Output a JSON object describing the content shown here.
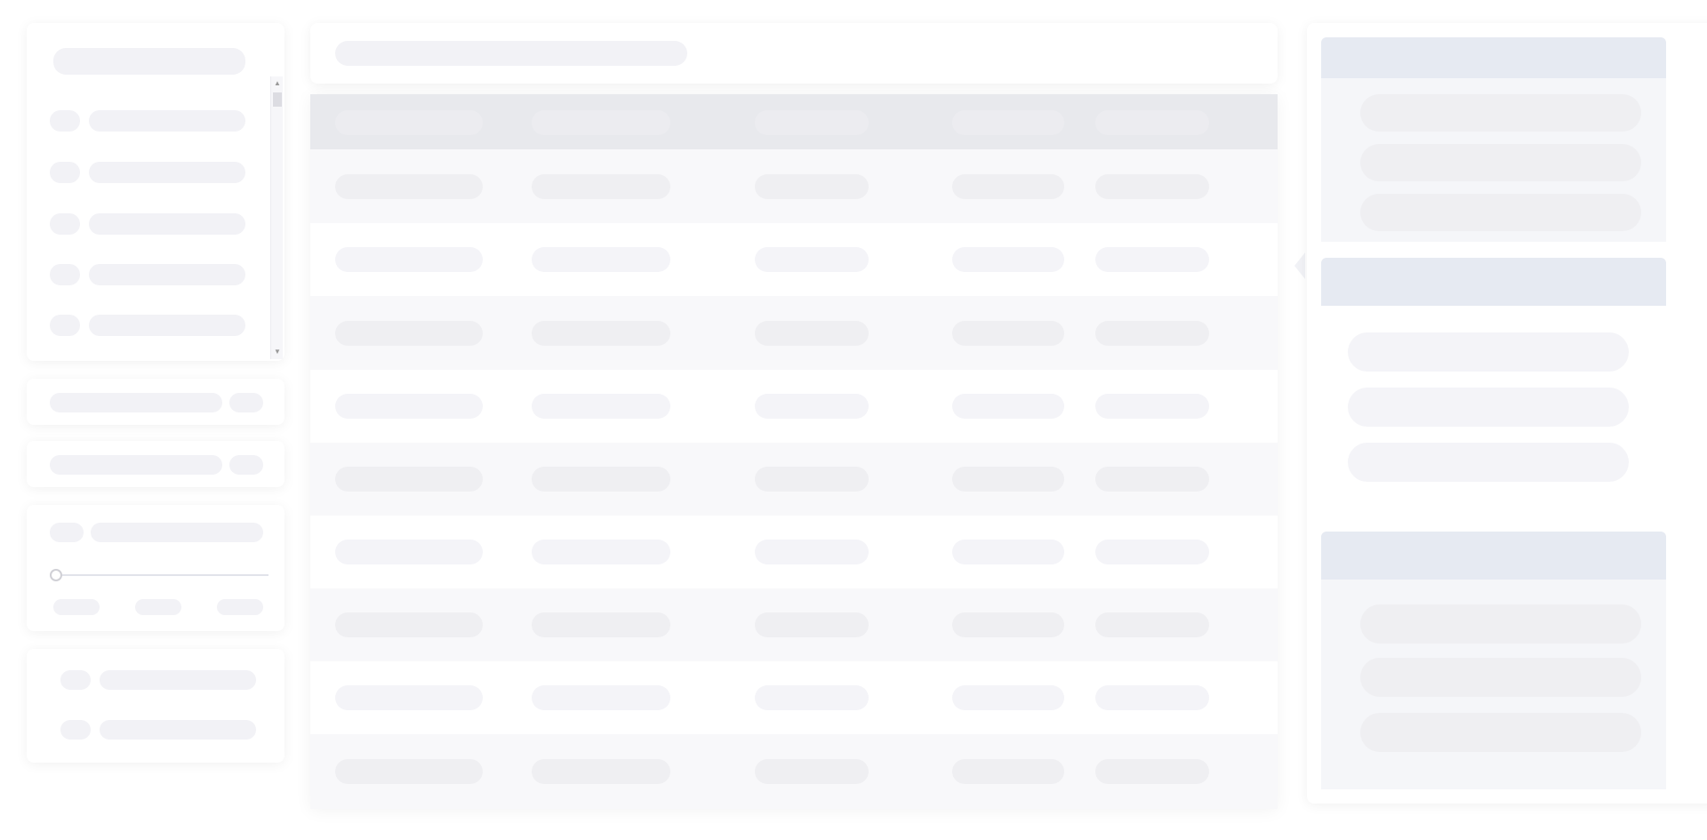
{
  "app": {
    "title": ""
  },
  "colors": {
    "skeleton": "#f2f2f6",
    "table_header": "#e8e9ed",
    "section_header": "#e6eaf2",
    "row_alt": "#f8f8fa"
  },
  "left_sidebar": {
    "filter_search_placeholder": "",
    "filter_items": [
      {
        "label": ""
      },
      {
        "label": ""
      },
      {
        "label": ""
      },
      {
        "label": ""
      },
      {
        "label": ""
      }
    ],
    "scroll_up_icon": "▲",
    "scroll_down_icon": "▼",
    "toggle_rows": [
      {
        "label": "",
        "value": ""
      },
      {
        "label": "",
        "value": ""
      }
    ],
    "slider": {
      "label": "",
      "value": 0,
      "tick_labels": [
        "",
        "",
        ""
      ]
    },
    "option_rows": [
      {
        "label": ""
      },
      {
        "label": ""
      }
    ]
  },
  "main": {
    "search_placeholder": "",
    "table": {
      "columns": [
        "",
        "",
        "",
        "",
        ""
      ],
      "rows": [
        [
          "",
          "",
          "",
          "",
          ""
        ],
        [
          "",
          "",
          "",
          "",
          ""
        ],
        [
          "",
          "",
          "",
          "",
          ""
        ],
        [
          "",
          "",
          "",
          "",
          ""
        ],
        [
          "",
          "",
          "",
          "",
          ""
        ],
        [
          "",
          "",
          "",
          "",
          ""
        ],
        [
          "",
          "",
          "",
          "",
          ""
        ],
        [
          "",
          "",
          "",
          "",
          ""
        ],
        [
          "",
          "",
          "",
          "",
          ""
        ]
      ]
    }
  },
  "right_panel": {
    "collapse_icon": "chevron-left-icon",
    "sections": [
      {
        "title": "",
        "items": [
          "",
          "",
          ""
        ]
      },
      {
        "title": "",
        "items": [
          "",
          "",
          ""
        ]
      },
      {
        "title": "",
        "items": [
          "",
          "",
          ""
        ]
      }
    ]
  }
}
